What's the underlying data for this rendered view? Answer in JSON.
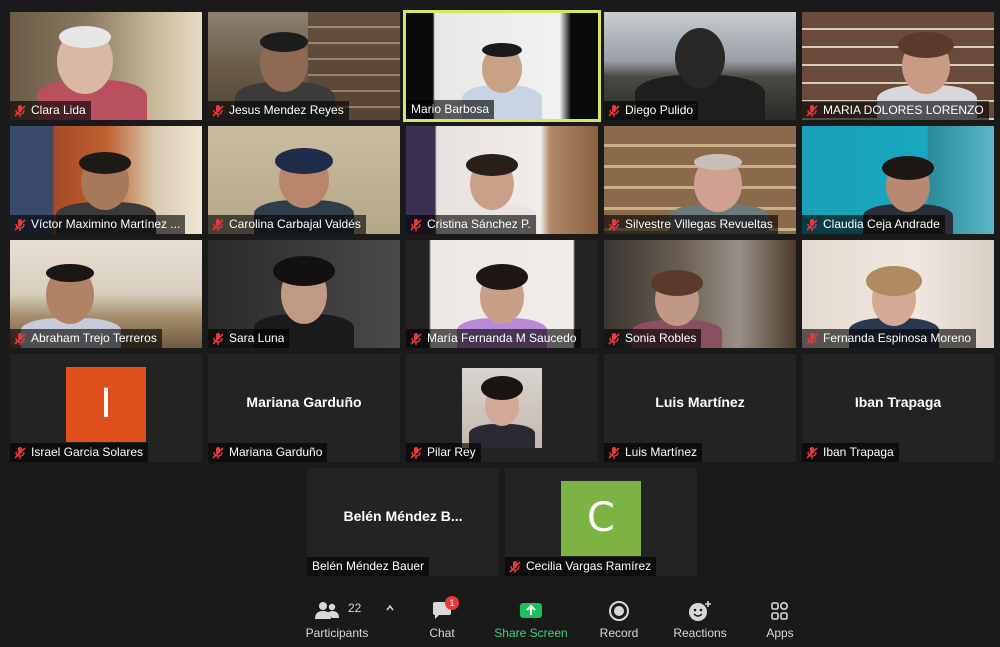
{
  "colors": {
    "background": "#1a1a1a",
    "tile": "#232323",
    "active_speaker_border": "#d8e36a",
    "muted_mic": "#e8383d",
    "share_screen": "#44d17a",
    "badge": "#e8383d"
  },
  "participants": [
    {
      "name": "Clara Lida",
      "video": true,
      "active": false
    },
    {
      "name": "Jesus Mendez Reyes",
      "video": true,
      "active": false
    },
    {
      "name": "Mario Barbosa",
      "video": true,
      "active": true
    },
    {
      "name": "Diego Pulido",
      "video": true,
      "active": false
    },
    {
      "name": "MARIA DOLORES LORENZO",
      "video": true,
      "active": false
    },
    {
      "name": "Víctor Maximino Martínez ...",
      "video": true,
      "active": false
    },
    {
      "name": "Carolina Carbajal Valdés",
      "video": true,
      "active": false
    },
    {
      "name": "Cristina Sánchez P.",
      "video": true,
      "active": false
    },
    {
      "name": "Silvestre Villegas Revueltas",
      "video": true,
      "active": false
    },
    {
      "name": "Claudia Ceja Andrade",
      "video": true,
      "active": false
    },
    {
      "name": "Abraham Trejo Terreros",
      "video": true,
      "active": false
    },
    {
      "name": "Sara Luna",
      "video": true,
      "active": false
    },
    {
      "name": "María Fernanda M Saucedo",
      "video": true,
      "active": false
    },
    {
      "name": "Sonia Robles",
      "video": true,
      "active": false
    },
    {
      "name": "Fernanda Espinosa Moreno",
      "video": true,
      "active": false
    },
    {
      "name": "Israel Garcia Solares",
      "video": false,
      "avatar_letter": "I",
      "avatar_color": "#e0501c"
    },
    {
      "name": "Mariana Garduño",
      "video": false,
      "center_text": "Mariana Garduño"
    },
    {
      "name": "Pilar Rey",
      "video": true,
      "active": false
    },
    {
      "name": "Luis Martínez",
      "video": false,
      "center_text": "Luis Martínez"
    },
    {
      "name": "Iban Trapaga",
      "video": false,
      "center_text": "Iban Trapaga"
    },
    {
      "name": "Belén Méndez Bauer",
      "video": false,
      "center_text": "Belén Méndez B..."
    },
    {
      "name": "Cecilia Vargas Ramírez",
      "video": false,
      "avatar_letter": "C",
      "avatar_color": "#7cb342"
    }
  ],
  "toolbar": {
    "participants_label": "Participants",
    "participants_count": "22",
    "chat_label": "Chat",
    "chat_badge": "1",
    "share_label": "Share Screen",
    "record_label": "Record",
    "reactions_label": "Reactions",
    "apps_label": "Apps",
    "participants_icon": "people-icon",
    "chat_icon": "chat-bubble-icon",
    "share_icon": "share-screen-arrow-icon",
    "record_icon": "record-icon",
    "reactions_icon": "smiley-plus-icon",
    "apps_icon": "apps-icon",
    "caret_icon": "caret-up-icon"
  }
}
